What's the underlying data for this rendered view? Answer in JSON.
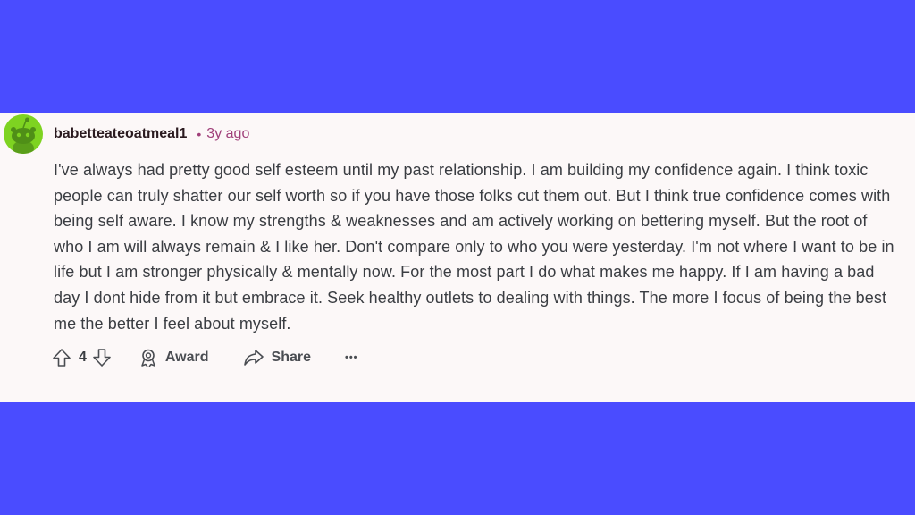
{
  "comment": {
    "username": "babetteateoatmeal1",
    "separator": "•",
    "timestamp": "3y ago",
    "text": "I've always had pretty good self esteem until my past relationship. I am building my confidence again. I think toxic people can truly shatter our self worth so if you have those folks cut them out. But I think true confidence comes with being self aware. I know my strengths & weaknesses and am actively working on bettering myself. But the root of who I am will always remain & I like her. Don't compare only to who you were yesterday. I'm not where I want to be in life but I am stronger physically & mentally now. For the most part I do what makes me happy. If I am having a bad day I dont hide from it but embrace it. Seek healthy outlets to dealing with things. The more I focus of being the best me the better I feel about myself."
  },
  "actions": {
    "vote_count": "4",
    "award_label": "Award",
    "share_label": "Share",
    "more_label": "•••"
  },
  "colors": {
    "background": "#4a4cff",
    "card": "#fcf8f8",
    "avatar": "#7ed321",
    "timestamp": "#a0407a"
  },
  "icons": [
    "avatar",
    "upvote-icon",
    "downvote-icon",
    "award-icon",
    "share-icon",
    "more-icon"
  ]
}
